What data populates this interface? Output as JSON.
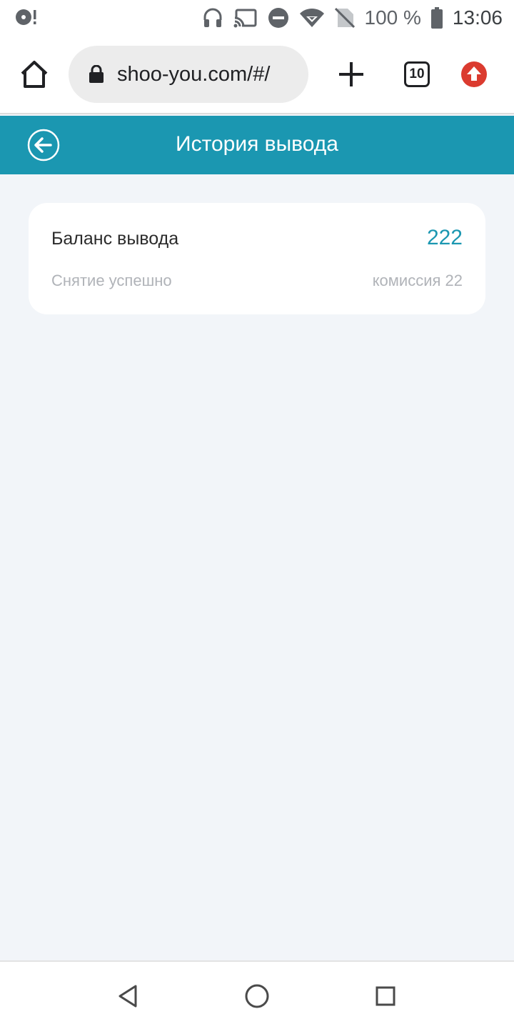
{
  "status_bar": {
    "battery_text": "100 %",
    "time": "13:06",
    "icons": [
      "media-notification-icon",
      "headset-icon",
      "cast-icon",
      "do-not-disturb-icon",
      "wifi-icon",
      "no-sim-icon",
      "battery-icon"
    ]
  },
  "browser": {
    "url": "shoo-you.com/#/",
    "tab_count": "10",
    "icons": [
      "home-icon",
      "lock-icon",
      "plus-icon",
      "tabs-icon",
      "update-icon"
    ]
  },
  "header": {
    "title": "История вывода",
    "back_icon": "back-arrow-icon",
    "color": "#1b97b1"
  },
  "withdrawal": {
    "title": "Баланс вывода",
    "amount": "222",
    "status": "Снятие успешно",
    "fee": "комиссия 22"
  },
  "nav": {
    "icons": [
      "back-triangle-icon",
      "home-circle-icon",
      "recents-square-icon"
    ]
  }
}
